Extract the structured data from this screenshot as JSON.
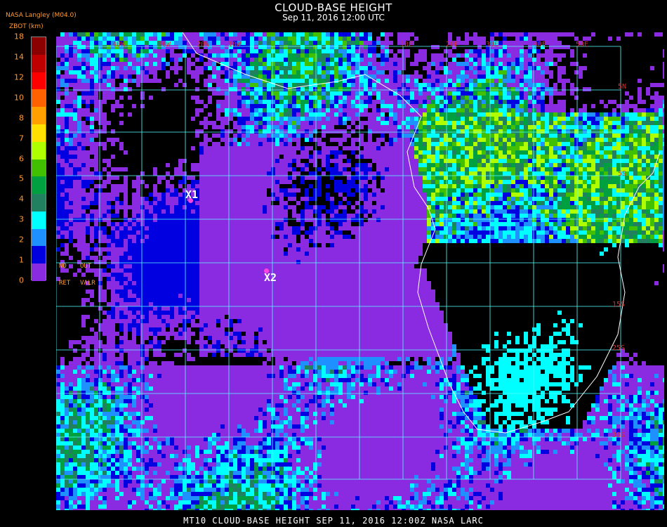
{
  "header": {
    "title": "CLOUD-BASE HEIGHT",
    "subtitle": "Sep 11, 2016 12:00 UTC",
    "source": "NASA Langley (M04.0)",
    "unit": "ZBOT (km)"
  },
  "legend": {
    "ticks": [
      "18",
      "14",
      "12",
      "10",
      "8",
      "7",
      "6",
      "5",
      "4",
      "3",
      "2",
      "1",
      "0"
    ],
    "colors": [
      "#8b0000",
      "#c00000",
      "#ff0000",
      "#ff6000",
      "#ffa000",
      "#ffe000",
      "#b0ff00",
      "#40c000",
      "#00a040",
      "#208060",
      "#00ffff",
      "#1e90ff",
      "#0000e0",
      "#8a2be2"
    ],
    "codes": {
      "no": "NO",
      "out": "OUT",
      "ret": "RET",
      "valr": "VALR"
    }
  },
  "map": {
    "markers": [
      {
        "label": "X1",
        "color": "#ff44dd"
      },
      {
        "label": "X2",
        "color": "#ff44dd"
      }
    ],
    "lat_labels": [
      "5N",
      "5S",
      "15S",
      "25S",
      "35S"
    ],
    "lon_labels": [
      "40W",
      "30W",
      "20W",
      "10W",
      "10E",
      "20E",
      "30E",
      "40E",
      "50E"
    ],
    "colors": {
      "grid": "#55ffff",
      "coast": "#ffffff",
      "ocean_clear": "#8a2be2"
    }
  },
  "footer": {
    "text": "MT10  CLOUD-BASE HEIGHT  SEP 11, 2016 12:00Z  NASA LARC"
  }
}
